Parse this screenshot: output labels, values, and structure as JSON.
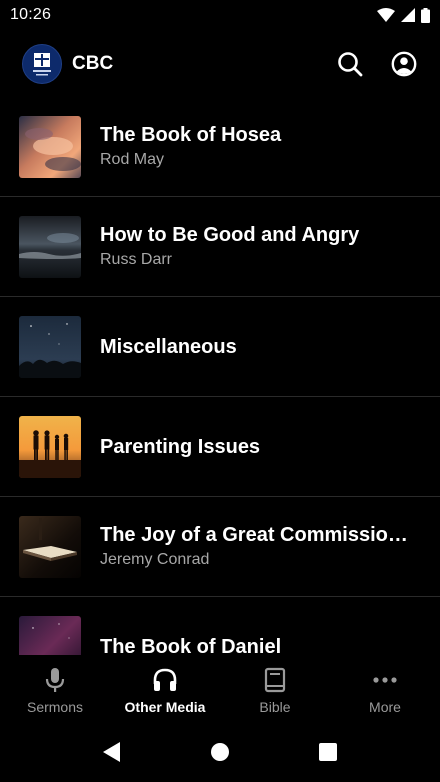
{
  "status_bar": {
    "time": "10:26",
    "icons": [
      "wifi-icon",
      "signal-icon",
      "battery-icon"
    ]
  },
  "header": {
    "title": "CBC",
    "logo": "church-logo",
    "actions": [
      "search-icon",
      "account-icon"
    ]
  },
  "media_list": [
    {
      "title": "The Book of Hosea",
      "subtitle": "Rod May",
      "thumb": "sunset-clouds"
    },
    {
      "title": "How to Be Good and Angry",
      "subtitle": "Russ Darr",
      "thumb": "stormy-sea"
    },
    {
      "title": "Miscellaneous",
      "subtitle": "",
      "thumb": "night-sky"
    },
    {
      "title": "Parenting Issues",
      "subtitle": "",
      "thumb": "family-sunset"
    },
    {
      "title": "The Joy of a Great Commission…",
      "subtitle": "Jeremy Conrad",
      "thumb": "open-bible"
    },
    {
      "title": "The Book of Daniel",
      "subtitle": "",
      "thumb": "purple-sky"
    }
  ],
  "bottom_nav": {
    "tabs": [
      {
        "label": "Sermons",
        "icon": "microphone-icon",
        "active": false
      },
      {
        "label": "Other Media",
        "icon": "headphones-icon",
        "active": true
      },
      {
        "label": "Bible",
        "icon": "book-icon",
        "active": false
      },
      {
        "label": "More",
        "icon": "more-horizontal-icon",
        "active": false
      }
    ]
  },
  "system_nav": [
    "back-icon",
    "home-icon",
    "recents-icon"
  ],
  "colors": {
    "background": "#000000",
    "text_primary": "#ffffff",
    "text_secondary": "#a8a8a8",
    "divider": "#2a2a2a",
    "logo_bg": "#0d2a6b"
  }
}
